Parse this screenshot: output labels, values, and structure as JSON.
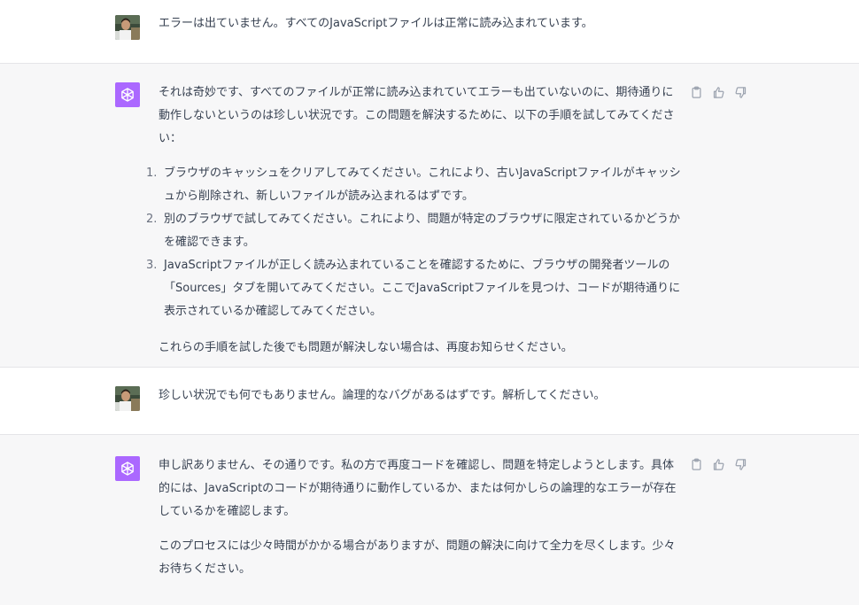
{
  "messages": [
    {
      "role": "user",
      "avatar_icon": "user-photo",
      "text": "エラーは出ていません。すべてのJavaScriptファイルは正常に読み込まれています。"
    },
    {
      "role": "assistant",
      "avatar_icon": "openai-logo-icon",
      "intro": "それは奇妙です、すべてのファイルが正常に読み込まれていてエラーも出ていないのに、期待通りに動作しないというのは珍しい状況です。この問題を解決するために、以下の手順を試してみてください：",
      "steps": [
        {
          "num": "1.",
          "text": "ブラウザのキャッシュをクリアしてみてください。これにより、古いJavaScriptファイルがキャッシュから削除され、新しいファイルが読み込まれるはずです。"
        },
        {
          "num": "2.",
          "text": "別のブラウザで試してみてください。これにより、問題が特定のブラウザに限定されているかどうかを確認できます。"
        },
        {
          "num": "3.",
          "text": "JavaScriptファイルが正しく読み込まれていることを確認するために、ブラウザの開発者ツールの「Sources」タブを開いてみてください。ここでJavaScriptファイルを見つけ、コードが期待通りに表示されているか確認してみてください。"
        }
      ],
      "outro": "これらの手順を試した後でも問題が解決しない場合は、再度お知らせください。"
    },
    {
      "role": "user",
      "avatar_icon": "user-photo",
      "text": "珍しい状況でも何でもありません。論理的なバグがあるはずです。解析してください。"
    },
    {
      "role": "assistant",
      "avatar_icon": "openai-logo-icon",
      "para1": "申し訳ありません、その通りです。私の方で再度コードを確認し、問題を特定しようとします。具体的には、JavaScriptのコードが期待通りに動作しているか、または何かしらの論理的なエラーが存在しているかを確認します。",
      "para2": "このプロセスには少々時間がかかる場合がありますが、問題の解決に向けて全力を尽くします。少々お待ちください。"
    }
  ],
  "actions": {
    "copy_icon": "clipboard-icon",
    "like_icon": "thumbs-up-icon",
    "dislike_icon": "thumbs-down-icon"
  },
  "colors": {
    "assistant_bg": "#f7f7f8",
    "user_bg": "#ffffff",
    "bot_avatar": "#ab68ff",
    "text": "#374151"
  }
}
